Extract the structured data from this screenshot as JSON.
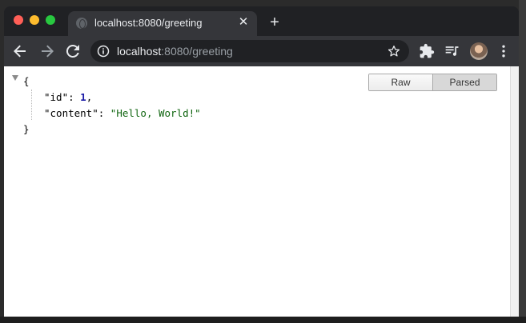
{
  "tab": {
    "title": "localhost:8080/greeting",
    "close_glyph": "✕",
    "new_tab_glyph": "+"
  },
  "omnibox": {
    "host": "localhost",
    "path": ":8080/greeting"
  },
  "json_view": {
    "open_brace": "{",
    "close_brace": "}",
    "key_id": "\"id\"",
    "value_id": "1",
    "key_content": "\"content\"",
    "value_content": "\"Hello, World!\"",
    "colon": ": ",
    "comma": ","
  },
  "view_toggle": {
    "raw_label": "Raw",
    "parsed_label": "Parsed",
    "selected": "Parsed"
  },
  "icons": {
    "back": "arrow-left-icon",
    "forward": "arrow-right-icon",
    "reload": "reload-icon",
    "info": "info-icon",
    "star": "star-icon",
    "extensions": "puzzle-icon",
    "media": "media-queue-icon",
    "menu": "kebab-menu-icon"
  },
  "colors": {
    "titlebar": "#202124",
    "toolbar": "#35363a",
    "json_number": "#1a1aa6",
    "json_string": "#116611"
  }
}
